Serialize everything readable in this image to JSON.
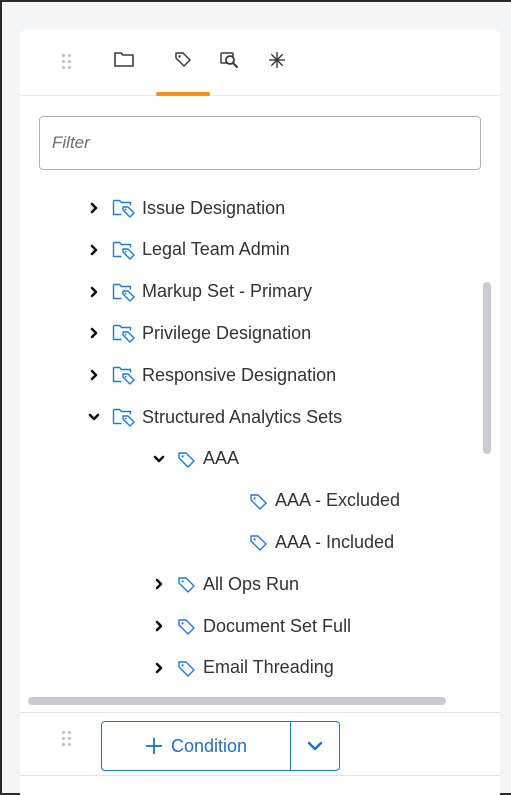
{
  "tabs": [
    {
      "name": "folder-icon"
    },
    {
      "name": "tag-icon",
      "active": true
    },
    {
      "name": "saved-search-icon"
    },
    {
      "name": "asterisk-icon"
    }
  ],
  "filter": {
    "placeholder": "Filter",
    "value": ""
  },
  "tree": {
    "items": [
      {
        "label": "Issue Designation",
        "type": "folder",
        "state": "collapsed",
        "level": 0
      },
      {
        "label": "Legal Team Admin",
        "type": "folder",
        "state": "collapsed",
        "level": 0
      },
      {
        "label": "Markup Set - Primary",
        "type": "folder",
        "state": "collapsed",
        "level": 0
      },
      {
        "label": "Privilege Designation",
        "type": "folder",
        "state": "collapsed",
        "level": 0
      },
      {
        "label": "Responsive Designation",
        "type": "folder",
        "state": "collapsed",
        "level": 0
      },
      {
        "label": "Structured Analytics Sets",
        "type": "folder",
        "state": "expanded",
        "level": 0
      },
      {
        "label": "AAA",
        "type": "tag",
        "state": "expanded",
        "level": 1
      },
      {
        "label": "AAA - Excluded",
        "type": "tag",
        "state": "leaf",
        "level": 2
      },
      {
        "label": "AAA - Included",
        "type": "tag",
        "state": "leaf",
        "level": 2
      },
      {
        "label": "All Ops Run",
        "type": "tag",
        "state": "collapsed",
        "level": 1
      },
      {
        "label": "Document Set Full",
        "type": "tag",
        "state": "collapsed",
        "level": 1
      },
      {
        "label": "Email Threading",
        "type": "tag",
        "state": "collapsed",
        "level": 1
      }
    ]
  },
  "footer": {
    "condition_label": "Condition"
  },
  "colors": {
    "accent": "#f0901e",
    "brand": "#1c78d0",
    "icon": "#1f7ad6"
  }
}
